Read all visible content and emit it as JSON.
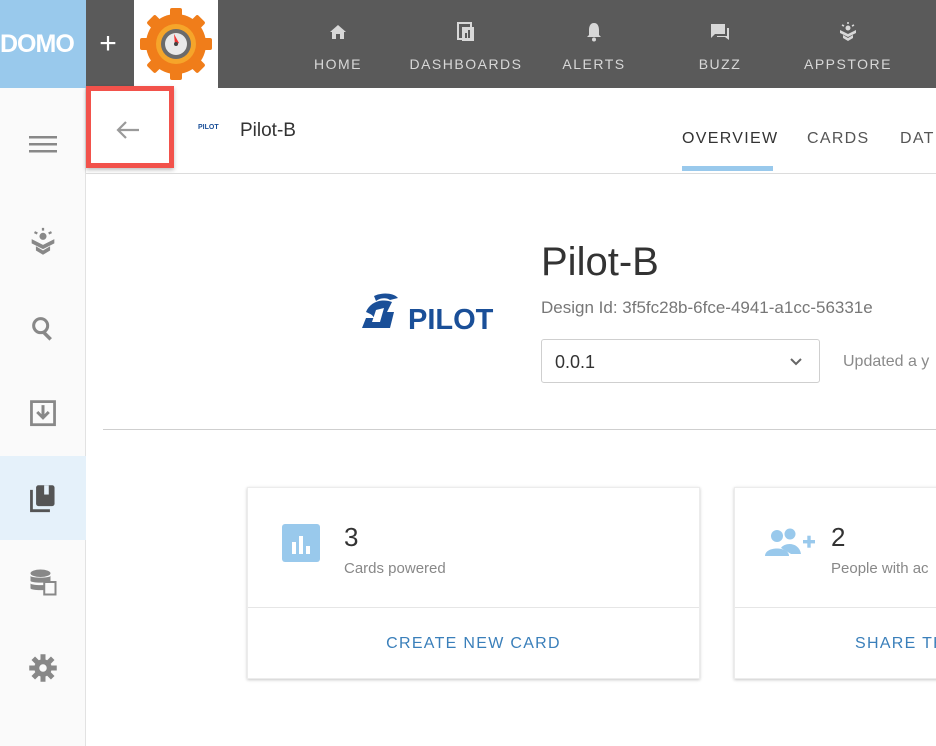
{
  "brand": {
    "logo_text": "DOMO"
  },
  "nav": {
    "items": [
      {
        "label": "HOME",
        "icon": "home-icon"
      },
      {
        "label": "DASHBOARDS",
        "icon": "dashboards-icon"
      },
      {
        "label": "ALERTS",
        "icon": "bell-icon"
      },
      {
        "label": "BUZZ",
        "icon": "chat-icon"
      },
      {
        "label": "APPSTORE",
        "icon": "appstore-icon"
      }
    ]
  },
  "header": {
    "title": "Pilot-B",
    "mini_logo_text": "PILOT",
    "tabs": [
      "OVERVIEW",
      "CARDS",
      "DAT"
    ]
  },
  "design": {
    "logo_text": "PILOT",
    "title": "Pilot-B",
    "design_id": "Design Id: 3f5fc28b-6fce-4941-a1cc-56331e",
    "version": "0.0.1",
    "updated": "Updated a y"
  },
  "cards": {
    "powered": {
      "count": "3",
      "label": "Cards powered",
      "action": "CREATE NEW CARD"
    },
    "people": {
      "count": "2",
      "label": "People with ac",
      "action": "SHARE TH"
    }
  },
  "colors": {
    "accent": "#99c9ec",
    "highlight": "#f2524b",
    "link": "#3a7fba",
    "topbar": "#5a5a5a"
  }
}
